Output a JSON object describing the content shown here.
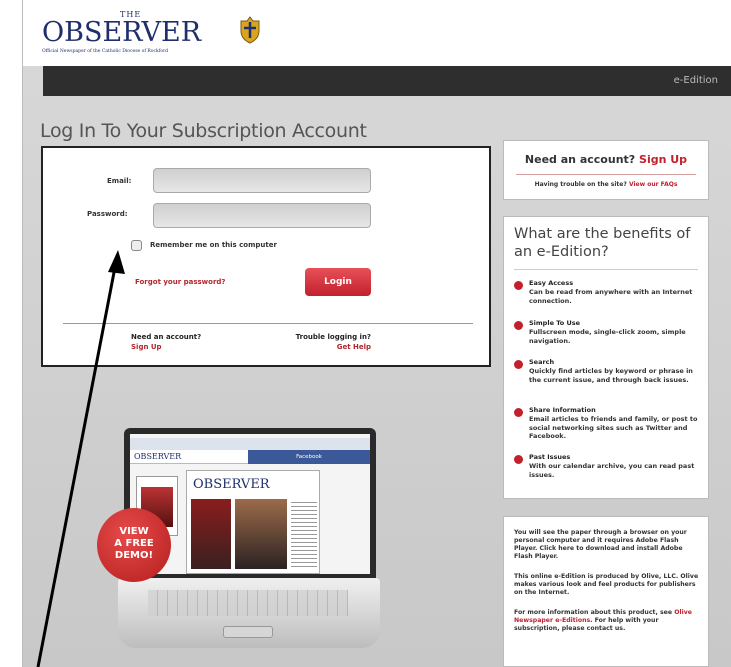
{
  "header": {
    "logo_the": "THE",
    "logo_name": "OBSERVER",
    "logo_tagline": "Official Newspaper of the Catholic Diocese of Rockford",
    "nav_link": "e-Edition"
  },
  "login": {
    "heading": "Log In To Your Subscription Account",
    "email_label": "Email:",
    "password_label": "Password:",
    "email_value": "",
    "password_value": "",
    "remember_label": "Remember me on this computer",
    "forgot_link": "Forgot your password?",
    "login_button": "Login",
    "need_account_text": "Need an account?",
    "sign_up_link": "Sign Up",
    "trouble_text": "Trouble logging in?",
    "get_help_link": "Get Help"
  },
  "sidebar": {
    "signup_box": {
      "title": "Need an account?",
      "title_link": "Sign Up",
      "subtext": "Having trouble on the site?",
      "subtext_link": "View our FAQs"
    },
    "benefits": {
      "heading": "What are the benefits of an e-Edition?",
      "items": [
        {
          "title": "Easy Access",
          "desc": "Can be read from anywhere with an Internet connection."
        },
        {
          "title": "Simple To Use",
          "desc": "Fullscreen mode, single-click zoom, simple navigation."
        },
        {
          "title": "Search",
          "desc": "Quickly find articles by keyword or phrase in the current issue, and through back issues."
        },
        {
          "title": "Share Information",
          "desc": "Email articles to friends and family, or post to social networking sites such as Twitter and Facebook."
        },
        {
          "title": "Past Issues",
          "desc": "With our calendar archive, you can read past issues."
        }
      ]
    },
    "info": {
      "p1": "You will see the paper through a browser on your personal computer and it requires Adobe Flash Player. Click here to download and install Adobe Flash Player.",
      "p2": "This online e-Edition is produced by Olive, LLC. Olive makes various look and feel products for publishers on the Internet.",
      "p3_a": "For more information about this product, see",
      "p3_link": "Olive Newspaper e-Editions",
      "p3_b": ". For help with your subscription, please contact us."
    }
  },
  "promo": {
    "badge_line1": "VIEW",
    "badge_line2": "A FREE",
    "badge_line3": "DEMO!",
    "screen_logo": "OBSERVER",
    "screen_mini_logo": "OBSERVER",
    "screen_tab": "Facebook"
  },
  "colors": {
    "brand_navy": "#1f2f6b",
    "accent_red": "#c2202c",
    "navbar": "#2e2e2e"
  }
}
